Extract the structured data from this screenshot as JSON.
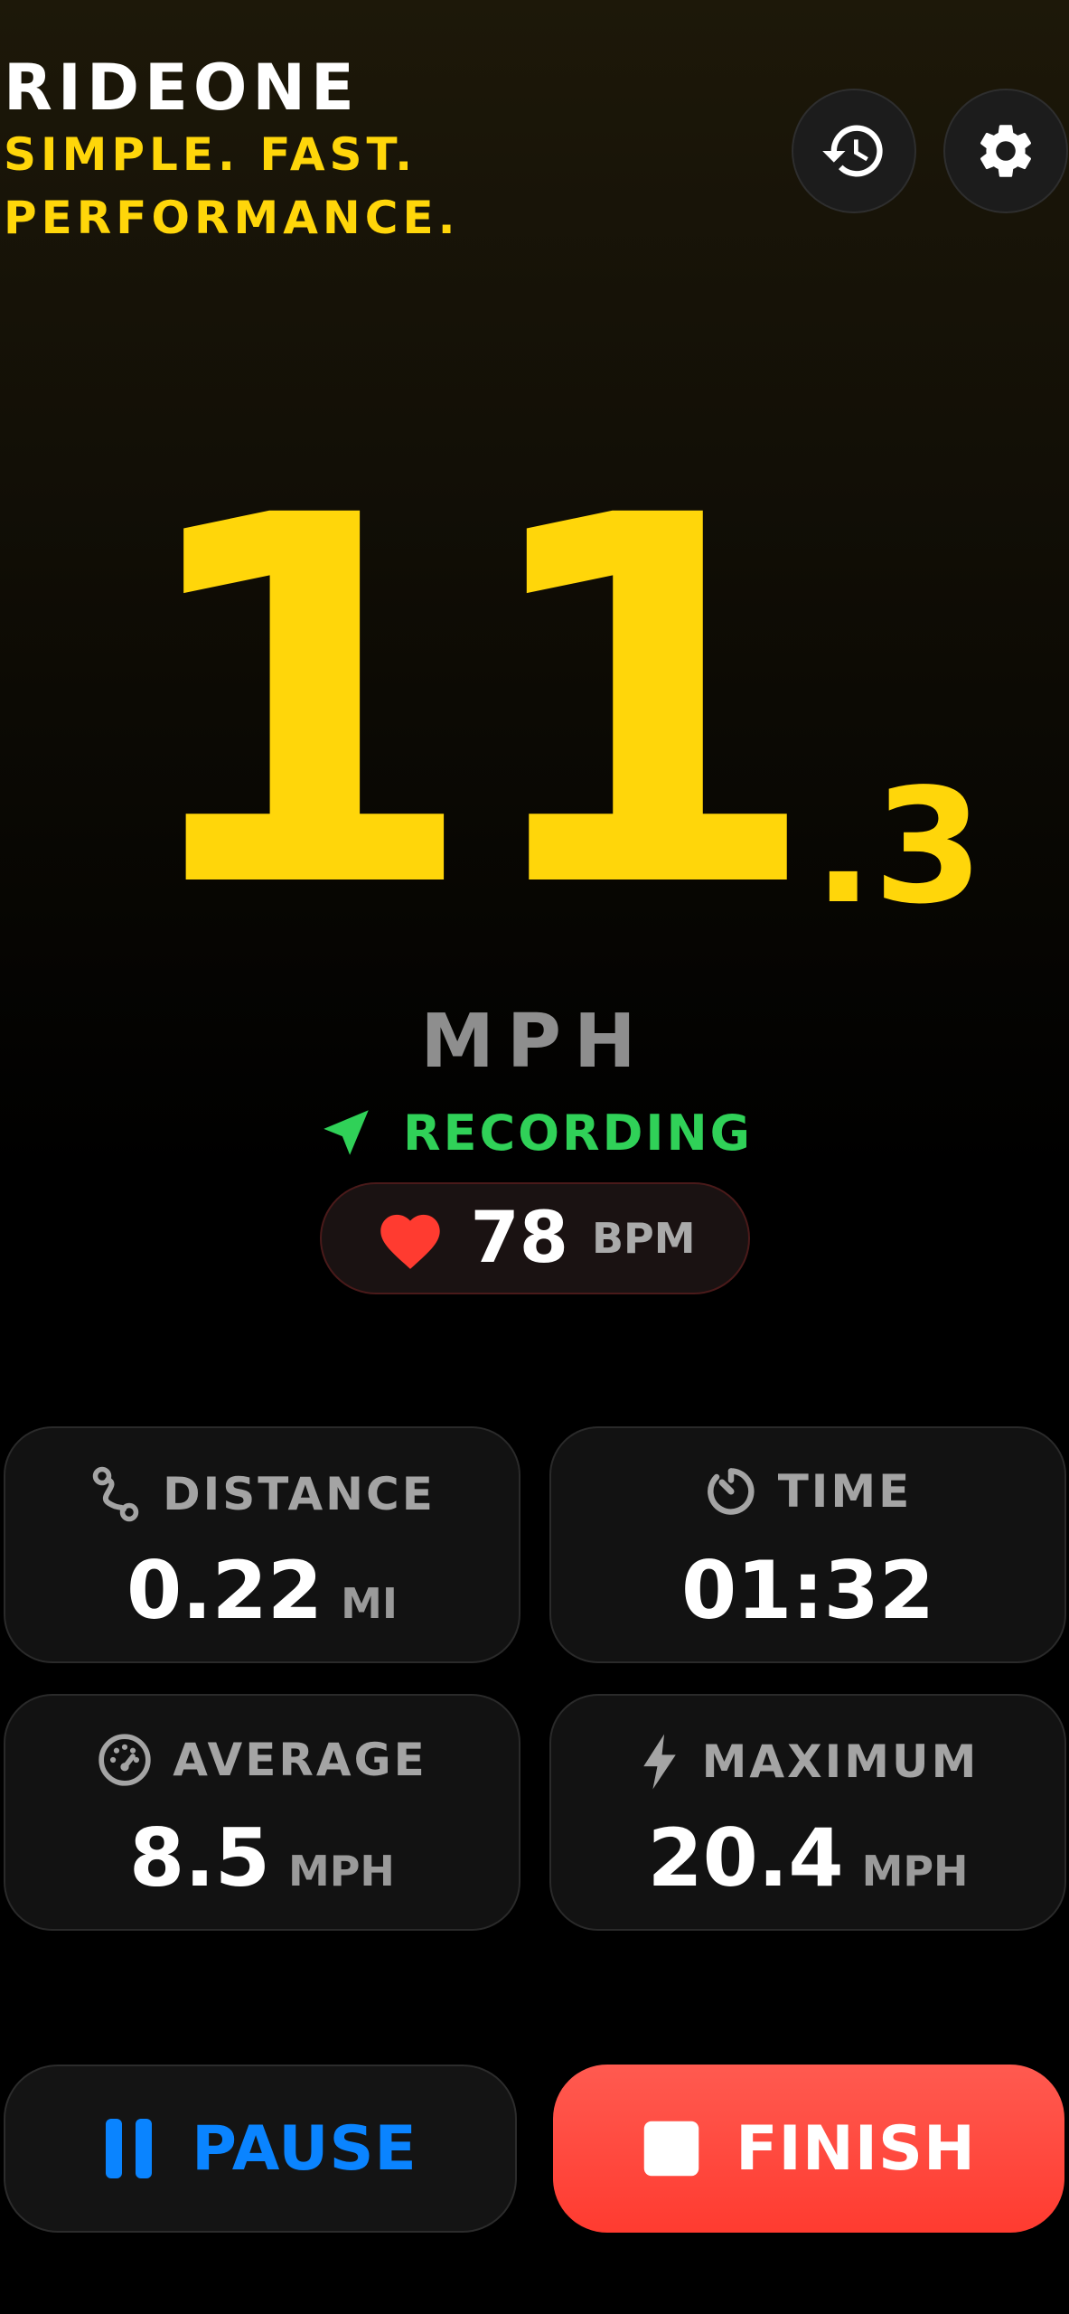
{
  "header": {
    "app_title": "RIDEONE",
    "tagline_line1": "SIMPLE. FAST.",
    "tagline_line2": "PERFORMANCE."
  },
  "icons": {
    "history": "history-icon",
    "settings": "gear-icon",
    "location": "location-arrow-icon",
    "heart": "heart-icon",
    "distance": "route-icon",
    "time": "timer-icon",
    "average": "speedometer-icon",
    "maximum": "bolt-icon",
    "pause": "pause-icon",
    "finish": "stop-icon"
  },
  "speed": {
    "integer": "11",
    "decimal": ".3",
    "unit": "MPH"
  },
  "status": {
    "recording_label": "RECORDING"
  },
  "heart_rate": {
    "value": "78",
    "unit": "BPM"
  },
  "stats": {
    "distance": {
      "label": "DISTANCE",
      "value": "0.22",
      "unit": "MI"
    },
    "time": {
      "label": "TIME",
      "value": "01:32"
    },
    "average": {
      "label": "AVERAGE",
      "value": "8.5",
      "unit": "MPH"
    },
    "maximum": {
      "label": "MAXIMUM",
      "value": "20.4",
      "unit": "MPH"
    }
  },
  "actions": {
    "pause_label": "PAUSE",
    "finish_label": "FINISH"
  },
  "colors": {
    "accent_yellow": "#ffd60a",
    "recording_green": "#30d158",
    "heart_red": "#ff3b30",
    "pause_blue": "#0a84ff",
    "finish_red": "#ff453a"
  }
}
